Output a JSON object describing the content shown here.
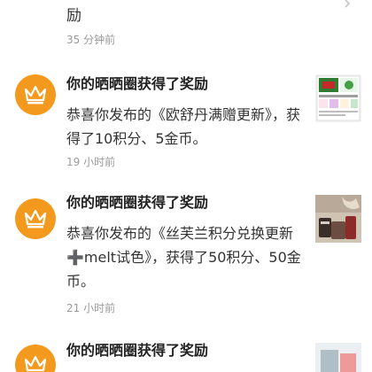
{
  "top_item": {
    "body_tail": "励",
    "time": "35 分钟前"
  },
  "notifications": [
    {
      "icon": "crown-icon",
      "title": "你的晒晒圈获得了奖励",
      "body": "恭喜你发布的《欧舒丹满赠更新》，获得了10积分、5金币。",
      "time": "19 小时前",
      "thumbnail_caption": "Cherry Pink Gift Box"
    },
    {
      "icon": "crown-icon",
      "title": "你的晒晒圈获得了奖励",
      "body": "恭喜你发布的《丝芙兰积分兑换更新➕melt试色》，获得了50积分、50金币。",
      "time": "21 小时前",
      "thumbnail_caption": ""
    },
    {
      "icon": "crown-icon",
      "title": "你的晒晒圈获得了奖励",
      "body": "",
      "time": "",
      "thumbnail_caption": ""
    }
  ],
  "colors": {
    "avatar_bg": "#f39a1e",
    "time_text": "#9a9a9a",
    "title_text": "#222222"
  }
}
